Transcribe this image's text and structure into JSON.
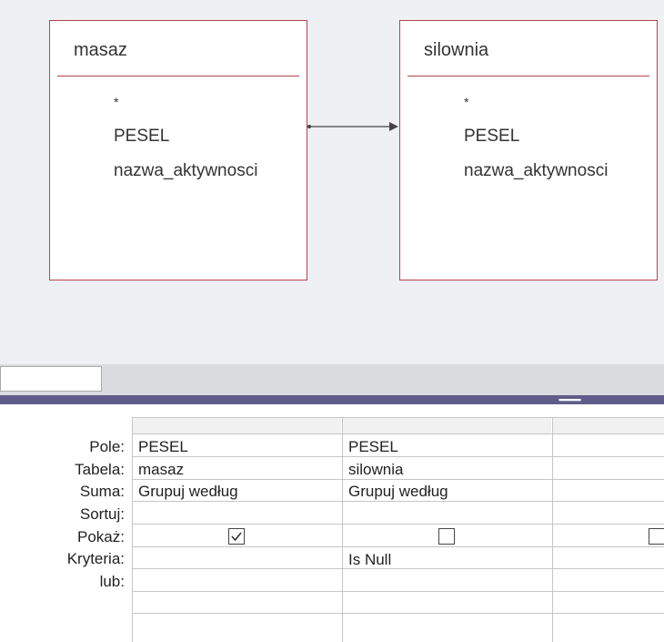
{
  "tables": [
    {
      "name": "masaz",
      "fields": [
        "*",
        "PESEL",
        "nazwa_aktywnosci"
      ]
    },
    {
      "name": "silownia",
      "fields": [
        "*",
        "PESEL",
        "nazwa_aktywnosci"
      ]
    }
  ],
  "grid": {
    "row_labels": [
      "Pole:",
      "Tabela:",
      "Suma:",
      "Sortuj:",
      "Pokaż:",
      "Kryteria:",
      "lub:"
    ],
    "columns": [
      {
        "pole": "PESEL",
        "tabela": "masaz",
        "suma": "Grupuj według",
        "sortuj": "",
        "pokaz": true,
        "kryteria": "",
        "lub": ""
      },
      {
        "pole": "PESEL",
        "tabela": "silownia",
        "suma": "Grupuj według",
        "sortuj": "",
        "pokaz": false,
        "kryteria": "Is Null",
        "lub": ""
      }
    ]
  },
  "colors": {
    "table_border": "#b4434c",
    "splitter": "#5f5b8a",
    "design_bg": "#eef0f3"
  }
}
